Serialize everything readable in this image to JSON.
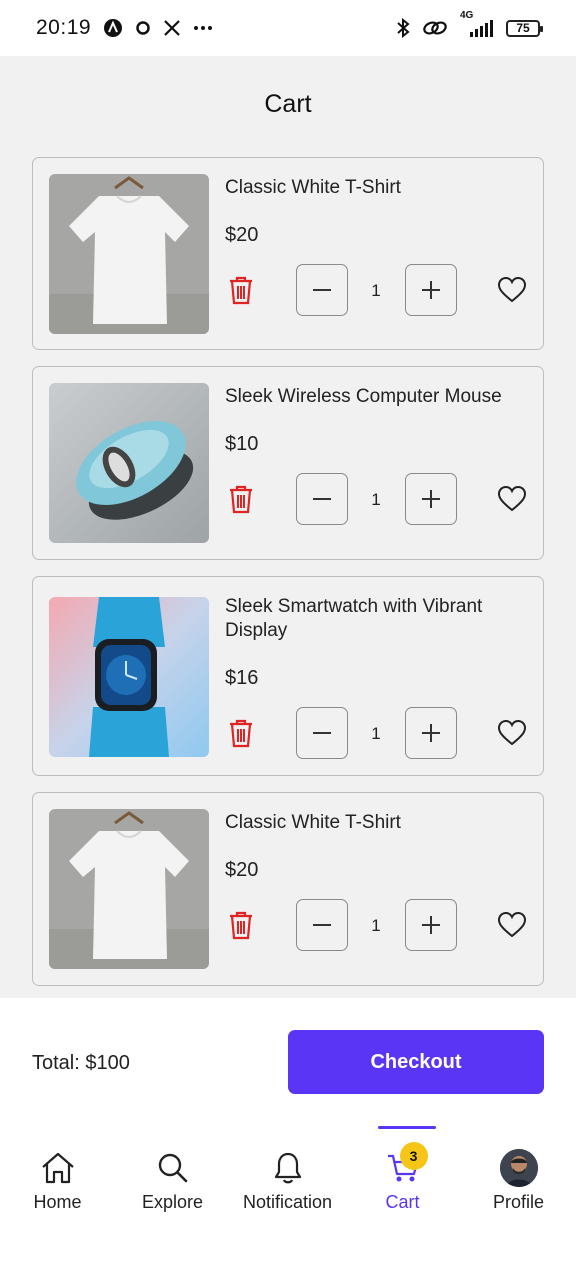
{
  "status_bar": {
    "time": "20:19",
    "left_icons": [
      "assistant-icon",
      "circle-icon",
      "x-icon",
      "more-icon"
    ],
    "right_icons": [
      "bluetooth-icon",
      "link-icon",
      "signal-icon"
    ],
    "network": "4G",
    "battery": "75"
  },
  "page": {
    "title": "Cart"
  },
  "cart": {
    "items": [
      {
        "name": "Classic White T-Shirt",
        "price": "$20",
        "quantity": "1",
        "image": "white-tshirt-image"
      },
      {
        "name": "Sleek Wireless Computer Mouse",
        "price": "$10",
        "quantity": "1",
        "image": "wireless-mouse-image"
      },
      {
        "name": "Sleek Smartwatch with Vibrant Display",
        "price": "$16",
        "quantity": "1",
        "image": "smartwatch-image"
      },
      {
        "name": "Classic White T-Shirt",
        "price": "$20",
        "quantity": "1",
        "image": "white-tshirt-image"
      }
    ]
  },
  "summary": {
    "total_label": "Total: $100",
    "checkout_label": "Checkout"
  },
  "nav": {
    "items": [
      {
        "label": "Home",
        "icon": "home-icon"
      },
      {
        "label": "Explore",
        "icon": "search-icon"
      },
      {
        "label": "Notification",
        "icon": "bell-icon"
      },
      {
        "label": "Cart",
        "icon": "cart-icon",
        "badge": "3",
        "active": true
      },
      {
        "label": "Profile",
        "icon": "avatar"
      }
    ]
  },
  "colors": {
    "accent": "#5b35f5",
    "delete": "#e02424",
    "badge": "#f5c518",
    "background": "#f1f1f1"
  }
}
